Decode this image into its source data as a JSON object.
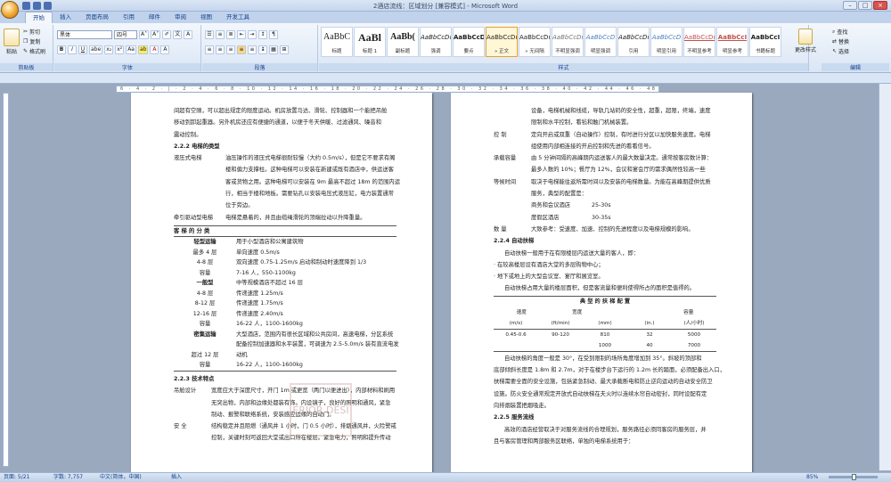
{
  "window": {
    "title": "2酒店流线：区域划分 [兼容模式] - Microsoft Word"
  },
  "tabs": [
    "开始",
    "插入",
    "页面布局",
    "引用",
    "邮件",
    "审阅",
    "视图",
    "开发工具"
  ],
  "ribbon": {
    "clipboard": {
      "paste": "粘贴",
      "cut": "剪切",
      "copy": "复制",
      "format_painter": "格式刷",
      "label": "剪贴板"
    },
    "font": {
      "name": "黑体",
      "size": "四号",
      "label": "字体"
    },
    "paragraph": {
      "label": "段落"
    },
    "styles": {
      "label": "样式",
      "items": [
        {
          "preview": "AaBbC",
          "name": "标题"
        },
        {
          "preview": "AaBl",
          "name": "标题 1"
        },
        {
          "preview": "AaBb(",
          "name": "副标题"
        },
        {
          "preview": "AaBbCcDd",
          "name": "强调"
        },
        {
          "preview": "AaBbCcD",
          "name": "要点"
        },
        {
          "preview": "AaBbCcDı",
          "name": "» 正文"
        },
        {
          "preview": "AaBbCcDı",
          "name": "» 无间隔"
        },
        {
          "preview": "AaBbCcDı",
          "name": "不明显强调"
        },
        {
          "preview": "AaBbCcD",
          "name": "明显强调"
        },
        {
          "preview": "AaBbCcDı",
          "name": "引用"
        },
        {
          "preview": "AaBbCcD",
          "name": "明显引用"
        },
        {
          "preview": "AaBbCcDı",
          "name": "不明显参考"
        },
        {
          "preview": "AaBbCcI",
          "name": "明显参考"
        },
        {
          "preview": "AaBbCcI",
          "name": "书籍标题"
        }
      ],
      "change": "更改样式"
    },
    "editing": {
      "find": "查找",
      "replace": "替换",
      "select": "选择",
      "label": "编辑"
    }
  },
  "ruler": "6 · 4 · 2 · | · 2 · 4 · 6 · 8 · 10 · 12 · 14 · 16 · 18 · 20 · 22 · 24 · 26 · 28 · 30 · 32 · 34 · 36 · 38 · 40 · 42 · 44 · 46 · 48 · 50 · 52",
  "page1": {
    "intro": [
      "间超有空隙，可以超出规定的限度运动。机房放置马达、滑轮、控制器和一个能把吊舱",
      "移动到卸起重器。另外机房还应有便捷的通道，以便于冬天供暖、过滤通风、噪音和",
      "震动控制。"
    ],
    "h1": "2.2.2  电梯的类型",
    "hydraulic_key": "液压式电梯",
    "hydraulic": [
      "油压操作的液压式电梯很耐较慢（大约 0.5m/s），但是它不要求有阁",
      "楼和偏力支撑柱。这种电梯可以安装在新建或既有酒店中，供运送客",
      "客或货物之用。这种电梯可以安装在 9m 最高不超过 18m 的范围内运",
      "行，相当于楼和地板。需要钻孔以安装电压式液压缸，电力装置通常",
      "位于旁边。"
    ],
    "traction_key": "牵引驱动型电梯",
    "traction": "电梯是悬着的，并且由缆绳滑轮的顶端拉动以升降重量。",
    "table": {
      "header": "客 梯 的 分 类",
      "rows": [
        {
          "k": "轻型运输",
          "v": "用于小型酒店和公寓建筑物"
        },
        {
          "k": "最多 4 层",
          "v": "单向速度 0.5m/s"
        },
        {
          "k": "4-8 层",
          "v": "双向速度 0.75-1.25m/s 启动和制动时速度降到 1/3"
        },
        {
          "k": "容量",
          "v": "7-16 人，550-1100kg"
        },
        {
          "k": "一般型",
          "v": "中等规模酒店不超过 16 层"
        },
        {
          "k": "4-8 层",
          "v": "传递速度    1.25m/s"
        },
        {
          "k": "8-12 层",
          "v": "传递速度    1.75m/s"
        },
        {
          "k": "12-16 层",
          "v": "传递速度    2.40m/s"
        },
        {
          "k": "容量",
          "v": "16-22 人，1100-1600kg"
        },
        {
          "k": "密集运输",
          "v": "大型酒店，范围内有很长区域和公共房间，高速电梯，分区系统"
        },
        {
          "k": "",
          "v": "配备控制加速器和水平装置，可调速为 2.5-5.0m/s 装有直流电发"
        },
        {
          "k": "超过 12 层",
          "v": "动机"
        },
        {
          "k": "容量",
          "v": "16-22 人，1100-1600kg"
        }
      ]
    },
    "h2": "2.2.3  技术特点",
    "crane_key": "吊舱设计",
    "crane": [
      "宽度应大于深度尺寸，开门 1m 或更宽（两门以便进出），内部材料和刷用",
      "无突出物，内部和边缘处都装有饰。内设镜子，良好的照明和通风，紧急",
      "制动、报警和联络系统，安装感应边缘的自动门。"
    ],
    "safety_key": "安      全",
    "safety": [
      "结构稳定并且阻燃（通风井 1 小时，门 0.5 小时），排烟通风井，火险警戒",
      "控制，关键时刻可返回大堂或出口所在楼层。紧急电力，照明和提升传动"
    ]
  },
  "page2": {
    "intro": [
      "设备，电梯机械和线缆，导轨几站码的安全性，超重，超限，终端，速度",
      "限制和水平控制，看毡和触门机械装置。"
    ],
    "rows": [
      {
        "k": "控      制",
        "v": [
          "定向开启或双重（自动操作）控制，有时进行分区以加快服务速度。电梯",
          "组使用内部相连接的开启控制和先进的看看信号。"
        ]
      },
      {
        "k": "承载容量",
        "v": [
          "由 5 分钟间隔的高峰期内运送客人的最大数量决定。通常按客房数计算：",
          "最多人数的 10%；餐厅为 12%，会议和宴会厅的需求偶然性较高一些"
        ]
      },
      {
        "k": "等候时间",
        "v": [
          "取决于电梯能往返所需时间以及安装的电梯数量。为能在高峰期提供优质",
          "服务，典型的配置是："
        ]
      }
    ],
    "wait": [
      {
        "k": "商务和会议酒店",
        "v": "25-30s"
      },
      {
        "k": "度假区酒店",
        "v": "30-35s"
      }
    ],
    "count_key": "数      量",
    "count": "大致参考：受速度、加速、控制的先进程度以及电梯规模的影响。",
    "h1": "2.2.4  自动扶梯",
    "esc": [
      "自动扶梯一般用于在有限楼层内运送大量的客人，即：",
      "· 在较高楼层设有酒店大堂的多层购物中心；",
      "· 地下或地上的大型会议室、宴厅和展览室。",
      "自动扶梯占用大量的楼层面积，但是客流量和便利使得所占的面积是值得的。"
    ],
    "table": {
      "header": "典 型 的 扶 梯 配 置",
      "cols": [
        "速度",
        "宽度",
        "",
        "容量"
      ],
      "units": [
        "(m/s)",
        "(ft/min)",
        "(mm)",
        "(in.)",
        "(人/小时)"
      ],
      "rows": [
        [
          "0.45-0.6",
          "90-120",
          "810",
          "32",
          "5000"
        ],
        [
          "",
          "",
          "1000",
          "40",
          "7000"
        ]
      ]
    },
    "after": [
      "自动扶梯的角度一般是 30°，在受到限制的场所角度增加到 35°。斜坡的顶部和",
      "底部倾斜长度是 1.8m 和 2.7m，对于在楼步台下运行的 1.2m 长的踏面，必须配备出入口，",
      "扶梯需要全面的安全设施，包括紧急制动、最大承载断电和防止逆向运动的自动安全防卫",
      "设施。防火安全通常规定开放式自动扶梯在夫火时以连续水帘自动密封，同时设配有定",
      "向排烟装置把烟吸走。"
    ],
    "h2": "2.2.5 服务流线",
    "svc": [
      "高效的酒店经营取决于对服务流线的合理规划，服务路径必须同客房的服务层，并",
      "且与客房管理和两部服务区联络，单独的电梯系统用于："
    ]
  },
  "watermark": "ERIOR DESI",
  "status": {
    "page": "页面: 5/21",
    "words": "字数: 7,757",
    "lang": "中文(简体，中国)",
    "mode": "插入",
    "zoom": "85%"
  }
}
